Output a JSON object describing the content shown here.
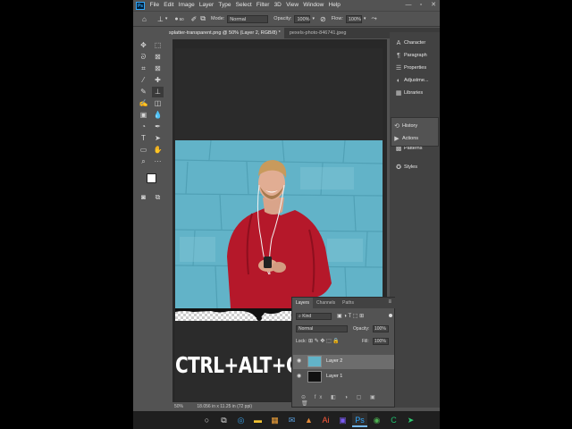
{
  "menu": {
    "logo": "Ps",
    "items": [
      "File",
      "Edit",
      "Image",
      "Layer",
      "Type",
      "Select",
      "Filter",
      "3D",
      "View",
      "Window",
      "Help"
    ]
  },
  "window_controls": [
    "—",
    "▫",
    "✕"
  ],
  "options_bar": {
    "brush_size": "50",
    "mode_label": "Mode:",
    "mode_value": "Normal",
    "opacity_label": "Opacity:",
    "opacity_value": "100%",
    "flow_label": "Flow:",
    "flow_value": "100%"
  },
  "tabs": [
    {
      "label": "splatter-transparent.png @ 50% (Layer 2, RGB/8) *",
      "active": true
    },
    {
      "label": "pexels-photo-846741.jpeg",
      "active": false
    }
  ],
  "panels": {
    "group1": [
      "Character",
      "Paragraph",
      "Properties",
      "Adjustme...",
      "Libraries"
    ],
    "group2": [
      "History",
      "Actions"
    ],
    "group3": [
      "Patterns",
      "Styles"
    ]
  },
  "canvas": {
    "shortcut_text": "CTRL+ALT+G"
  },
  "status": {
    "zoom": "50%",
    "doc_info": "18.056 in x 11.25 in (72 ppi)"
  },
  "layers_panel": {
    "tabs": [
      "Layers",
      "Channels",
      "Paths"
    ],
    "kind_label": "Kind",
    "blend_mode": "Normal",
    "opacity_label": "Opacity:",
    "opacity_value": "100%",
    "lock_label": "Lock:",
    "fill_label": "Fill:",
    "fill_value": "100%",
    "layers": [
      {
        "name": "Layer 2",
        "selected": true
      },
      {
        "name": "Layer 1",
        "selected": false
      }
    ]
  },
  "colors": {
    "app_bg": "#535353",
    "canvas_bg": "#282828",
    "photo_wall": "#5fb2c7",
    "shirt_red": "#b5182a",
    "selected_layer": "#6d6d6d"
  }
}
